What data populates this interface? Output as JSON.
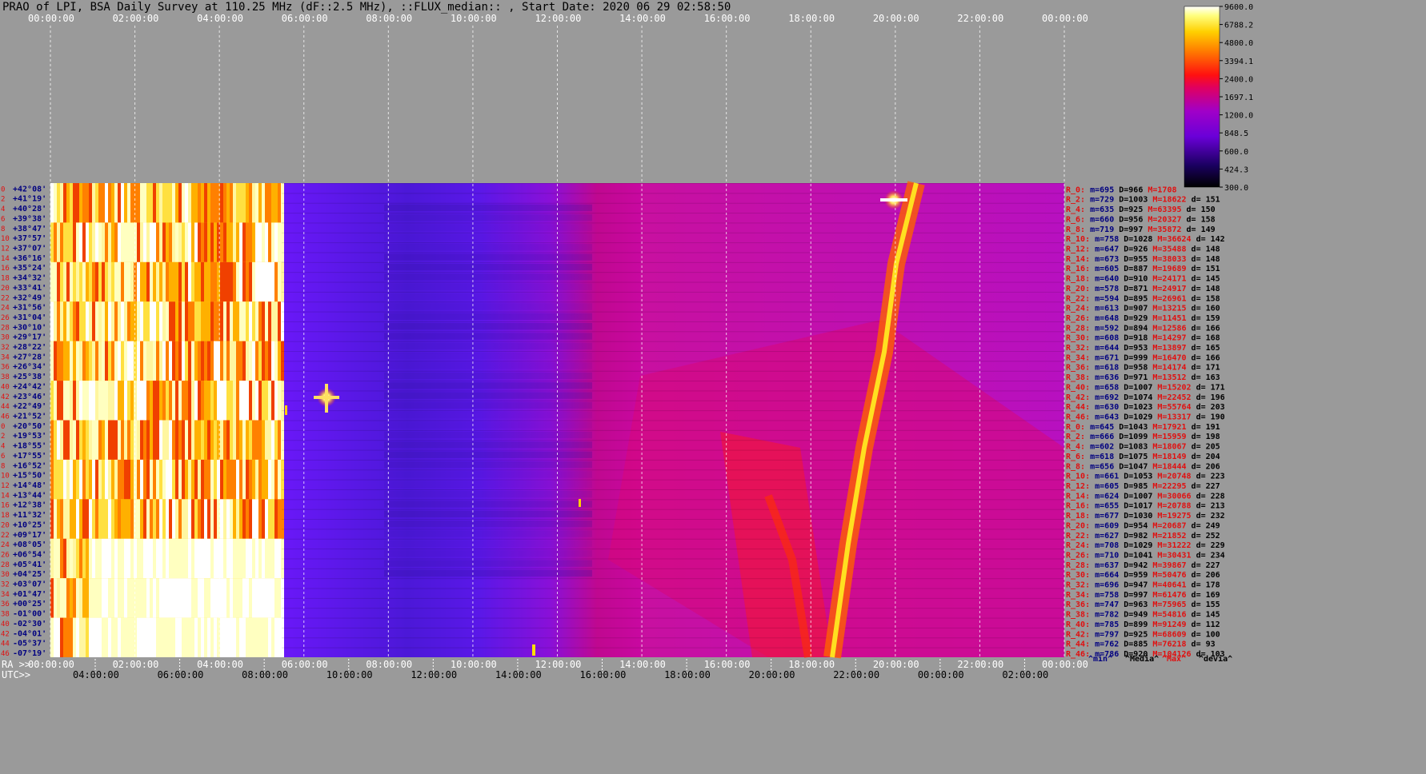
{
  "title": "PRAO of LPI, BSA Daily Survey at 110.25 MHz (dF::2.5 MHz), ::FLUX_median:: , Start Date: 2020 06 29 02:58:50",
  "chart_data": {
    "type": "heatmap",
    "title": "PRAO of LPI, BSA Daily Survey at 110.25 MHz (dF::2.5 MHz), ::FLUX_median:: , Start Date: 2020 06 29 02:58:50",
    "colorbar": {
      "ticks": [
        "9600.0",
        "6788.2",
        "4800.0",
        "3394.1",
        "2400.0",
        "1697.1",
        "1200.0",
        "848.5",
        "600.0",
        "424.3",
        "300.0"
      ],
      "scale": "log",
      "range": [
        300.0,
        9600.0
      ]
    },
    "top_axis_ticks": [
      "00:00:00",
      "02:00:00",
      "04:00:00",
      "06:00:00",
      "08:00:00",
      "10:00:00",
      "12:00:00",
      "14:00:00",
      "16:00:00",
      "18:00:00",
      "20:00:00",
      "22:00:00",
      "00:00:00"
    ],
    "ra_axis": {
      "prefix": "RA >>",
      "ticks": [
        "00:00:00",
        "02:00:00",
        "04:00:00",
        "06:00:00",
        "08:00:00",
        "10:00:00",
        "12:00:00",
        "14:00:00",
        "16:00:00",
        "18:00:00",
        "20:00:00",
        "22:00:00",
        "00:00:00"
      ]
    },
    "utc_axis": {
      "prefix": "UTC>>",
      "ticks": [
        "04:00:00",
        "06:00:00",
        "08:00:00",
        "10:00:00",
        "12:00:00",
        "14:00:00",
        "16:00:00",
        "18:00:00",
        "20:00:00",
        "22:00:00",
        "00:00:00",
        "02:00:00"
      ]
    },
    "row_indices": [
      "0",
      "2",
      "4",
      "6",
      "8",
      "10",
      "12",
      "14",
      "16",
      "18",
      "20",
      "22",
      "24",
      "26",
      "28",
      "30",
      "32",
      "34",
      "36",
      "38",
      "40",
      "42",
      "44",
      "46",
      "0",
      "2",
      "4",
      "6",
      "8",
      "10",
      "12",
      "14",
      "16",
      "18",
      "20",
      "22",
      "24",
      "26",
      "28",
      "30",
      "32",
      "34",
      "36",
      "38",
      "40",
      "42",
      "44",
      "46"
    ],
    "declinations": [
      "+42°08'",
      "+41°19'",
      "+40°28'",
      "+39°38'",
      "+38°47'",
      "+37°57'",
      "+37°07'",
      "+36°16'",
      "+35°24'",
      "+34°32'",
      "+33°41'",
      "+32°49'",
      "+31°56'",
      "+31°04'",
      "+30°10'",
      "+29°17'",
      "+28°22'",
      "+27°28'",
      "+26°34'",
      "+25°38'",
      "+24°42'",
      "+23°46'",
      "+22°49'",
      "+21°52'",
      "+20°50'",
      "+19°53'",
      "+18°55'",
      "+17°55'",
      "+16°52'",
      "+15°50'",
      "+14°48'",
      "+13°44'",
      "+12°38'",
      "+11°32'",
      "+10°25'",
      "+09°17'",
      "+08°05'",
      "+06°54'",
      "+05°41'",
      "+04°25'",
      "+03°07'",
      "+01°47'",
      "+00°25'",
      "-01°00'",
      "-02°30'",
      "-04°01'",
      "-05°37'",
      "-07°19'"
    ],
    "row_stats": [
      {
        "r": "R_0:",
        "m": "695",
        "D": "966",
        "M": "1708",
        "d": ""
      },
      {
        "r": "R_2:",
        "m": "729",
        "D": "1003",
        "M": "18622",
        "d": "151"
      },
      {
        "r": "R_4:",
        "m": "635",
        "D": "925",
        "M": "63395",
        "d": "150"
      },
      {
        "r": "R_6:",
        "m": "660",
        "D": "956",
        "M": "20327",
        "d": "158"
      },
      {
        "r": "R_8:",
        "m": "719",
        "D": "997",
        "M": "35872",
        "d": "149"
      },
      {
        "r": "R_10:",
        "m": "758",
        "D": "1028",
        "M": "36624",
        "d": "142"
      },
      {
        "r": "R_12:",
        "m": "647",
        "D": "926",
        "M": "35488",
        "d": "148"
      },
      {
        "r": "R_14:",
        "m": "673",
        "D": "955",
        "M": "38033",
        "d": "148"
      },
      {
        "r": "R_16:",
        "m": "605",
        "D": "887",
        "M": "19689",
        "d": "151"
      },
      {
        "r": "R_18:",
        "m": "640",
        "D": "910",
        "M": "24171",
        "d": "145"
      },
      {
        "r": "R_20:",
        "m": "578",
        "D": "871",
        "M": "24917",
        "d": "148"
      },
      {
        "r": "R_22:",
        "m": "594",
        "D": "895",
        "M": "26961",
        "d": "158"
      },
      {
        "r": "R_24:",
        "m": "613",
        "D": "907",
        "M": "13215",
        "d": "160"
      },
      {
        "r": "R_26:",
        "m": "648",
        "D": "929",
        "M": "11451",
        "d": "159"
      },
      {
        "r": "R_28:",
        "m": "592",
        "D": "894",
        "M": "12586",
        "d": "166"
      },
      {
        "r": "R_30:",
        "m": "608",
        "D": "918",
        "M": "14297",
        "d": "168"
      },
      {
        "r": "R_32:",
        "m": "644",
        "D": "953",
        "M": "13897",
        "d": "165"
      },
      {
        "r": "R_34:",
        "m": "671",
        "D": "999",
        "M": "16470",
        "d": "166"
      },
      {
        "r": "R_36:",
        "m": "618",
        "D": "958",
        "M": "14174",
        "d": "171"
      },
      {
        "r": "R_38:",
        "m": "636",
        "D": "971",
        "M": "13512",
        "d": "163"
      },
      {
        "r": "R_40:",
        "m": "658",
        "D": "1007",
        "M": "15202",
        "d": "171"
      },
      {
        "r": "R_42:",
        "m": "692",
        "D": "1074",
        "M": "22452",
        "d": "196"
      },
      {
        "r": "R_44:",
        "m": "630",
        "D": "1023",
        "M": "55764",
        "d": "203"
      },
      {
        "r": "R_46:",
        "m": "643",
        "D": "1029",
        "M": "13317",
        "d": "190"
      },
      {
        "r": "R_0:",
        "m": "645",
        "D": "1043",
        "M": "17921",
        "d": "191"
      },
      {
        "r": "R_2:",
        "m": "666",
        "D": "1099",
        "M": "15959",
        "d": "198"
      },
      {
        "r": "R_4:",
        "m": "602",
        "D": "1083",
        "M": "18067",
        "d": "205"
      },
      {
        "r": "R_6:",
        "m": "618",
        "D": "1075",
        "M": "18149",
        "d": "204"
      },
      {
        "r": "R_8:",
        "m": "656",
        "D": "1047",
        "M": "18444",
        "d": "206"
      },
      {
        "r": "R_10:",
        "m": "661",
        "D": "1053",
        "M": "20748",
        "d": "223"
      },
      {
        "r": "R_12:",
        "m": "605",
        "D": "985",
        "M": "22295",
        "d": "227"
      },
      {
        "r": "R_14:",
        "m": "624",
        "D": "1007",
        "M": "30066",
        "d": "228"
      },
      {
        "r": "R_16:",
        "m": "655",
        "D": "1017",
        "M": "20788",
        "d": "213"
      },
      {
        "r": "R_18:",
        "m": "677",
        "D": "1030",
        "M": "19275",
        "d": "232"
      },
      {
        "r": "R_20:",
        "m": "609",
        "D": "954",
        "M": "20687",
        "d": "249"
      },
      {
        "r": "R_22:",
        "m": "627",
        "D": "982",
        "M": "21852",
        "d": "252"
      },
      {
        "r": "R_24:",
        "m": "708",
        "D": "1029",
        "M": "31222",
        "d": "229"
      },
      {
        "r": "R_26:",
        "m": "710",
        "D": "1041",
        "M": "30431",
        "d": "234"
      },
      {
        "r": "R_28:",
        "m": "637",
        "D": "942",
        "M": "39867",
        "d": "227"
      },
      {
        "r": "R_30:",
        "m": "664",
        "D": "959",
        "M": "50476",
        "d": "206"
      },
      {
        "r": "R_32:",
        "m": "696",
        "D": "947",
        "M": "40641",
        "d": "178"
      },
      {
        "r": "R_34:",
        "m": "758",
        "D": "997",
        "M": "61476",
        "d": "169"
      },
      {
        "r": "R_36:",
        "m": "747",
        "D": "963",
        "M": "75965",
        "d": "155"
      },
      {
        "r": "R_38:",
        "m": "782",
        "D": "949",
        "M": "54816",
        "d": "145"
      },
      {
        "r": "R_40:",
        "m": "785",
        "D": "899",
        "M": "91249",
        "d": "112"
      },
      {
        "r": "R_42:",
        "m": "797",
        "D": "925",
        "M": "68609",
        "d": "100"
      },
      {
        "r": "R_44:",
        "m": "762",
        "D": "885",
        "M": "76218",
        "d": "93"
      },
      {
        "r": "R_46:",
        "m": "786",
        "D": "920",
        "M": "104126",
        "d": "103"
      }
    ],
    "stat_legend": [
      "^min^",
      "^Media^",
      "^Max^",
      "^devia^"
    ]
  },
  "colors": {
    "background": "#9a9a9a",
    "label_red": "#e01010",
    "label_blue": "#000080",
    "label_green": "#005000"
  }
}
